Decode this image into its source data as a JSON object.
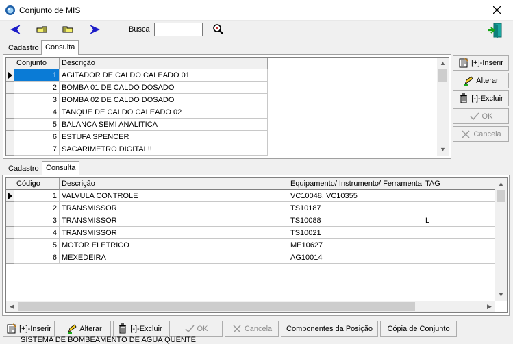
{
  "window": {
    "title": "Conjunto de MIS"
  },
  "toolbar": {
    "busca_label": "Busca",
    "busca_value": ""
  },
  "top_tabs": [
    {
      "label": "Cadastro"
    },
    {
      "label": "Consulta"
    }
  ],
  "bottom_tabs": [
    {
      "label": "Cadastro"
    },
    {
      "label": "Consulta"
    }
  ],
  "top_grid": {
    "columns": [
      "Conjunto",
      "Descrição"
    ],
    "rows": [
      {
        "conjunto": "1",
        "descricao": "AGITADOR DE CALDO CALEADO 01"
      },
      {
        "conjunto": "2",
        "descricao": "BOMBA 01 DE CALDO DOSADO"
      },
      {
        "conjunto": "3",
        "descricao": "BOMBA 02 DE CALDO DOSADO"
      },
      {
        "conjunto": "4",
        "descricao": "TANQUE DE CALDO CALEADO 02"
      },
      {
        "conjunto": "5",
        "descricao": "BALANCA SEMI ANALITICA"
      },
      {
        "conjunto": "6",
        "descricao": "ESTUFA SPENCER"
      },
      {
        "conjunto": "7",
        "descricao": "SACARIMETRO DIGITAL!!"
      }
    ]
  },
  "side_buttons": {
    "inserir": "[+]-Inserir",
    "alterar": "Alterar",
    "excluir": "[-]-Excluir",
    "ok": "OK",
    "cancela": "Cancela"
  },
  "bottom_grid": {
    "columns": [
      "Código",
      "Descrição",
      "Equipamento/ Instrumento/ Ferramenta",
      "TAG"
    ],
    "rows": [
      {
        "codigo": "1",
        "descricao": "VALVULA CONTROLE",
        "equip": "VC10048, VC10355",
        "tag": ""
      },
      {
        "codigo": "2",
        "descricao": "TRANSMISSOR",
        "equip": "TS10187",
        "tag": ""
      },
      {
        "codigo": "3",
        "descricao": "TRANSMISSOR",
        "equip": "TS10088",
        "tag": "L"
      },
      {
        "codigo": "4",
        "descricao": "TRANSMISSOR",
        "equip": "TS10021",
        "tag": ""
      },
      {
        "codigo": "5",
        "descricao": "MOTOR ELETRICO",
        "equip": "ME10627",
        "tag": ""
      },
      {
        "codigo": "6",
        "descricao": "MEXEDEIRA",
        "equip": "AG10014",
        "tag": ""
      }
    ]
  },
  "bottom_buttons": {
    "inserir": "[+]-Inserir",
    "alterar": "Alterar",
    "excluir": "[-]-Excluir",
    "ok": "OK",
    "cancela": "Cancela",
    "componentes": "Componentes da Posição",
    "copia": "Cópia de Conjunto"
  },
  "status": {
    "text": "SISTEMA DE BOMBEAMENTO DE AGUA QUENTE"
  },
  "colors": {
    "selection": "#0a7bd6",
    "nav_arrow": "#1c1cc8"
  }
}
